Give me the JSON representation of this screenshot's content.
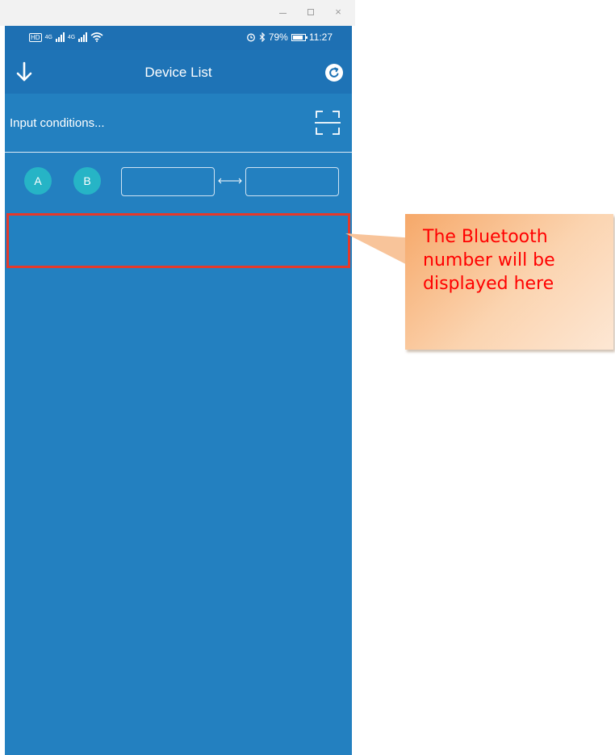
{
  "window": {
    "controls": [
      "–",
      "□",
      "×"
    ]
  },
  "status_bar": {
    "left_text": "HD",
    "signal_labels": [
      "4G",
      "4G"
    ],
    "battery": "79%",
    "time": "11:27"
  },
  "app_bar": {
    "title": "Device List",
    "left_icon": "arrow-down-icon",
    "right_icon": "refresh-icon"
  },
  "search": {
    "placeholder": "Input conditions...",
    "value": "",
    "scan_icon": "scan-icon"
  },
  "filters": {
    "button_a": "A",
    "button_b": "B",
    "range_min": "",
    "range_max": ""
  },
  "device_list": {
    "items": [
      {
        "text": ""
      }
    ]
  },
  "callout": {
    "text": "The Bluetooth number will be displayed here"
  },
  "colors": {
    "screen_bg": "#2380c0",
    "app_bar_bg": "#1e73b6",
    "accent_teal": "#26b4c6",
    "highlight_red": "#e5392a",
    "callout_text": "#ff0000"
  }
}
